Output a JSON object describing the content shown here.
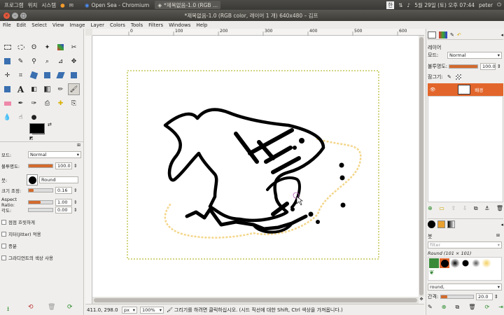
{
  "topbar": {
    "menus": [
      "프로그램",
      "위치",
      "시스템"
    ],
    "tasks": [
      "Open Sea - Chromium",
      "*제목없음-1.0 (RGB ..."
    ],
    "clock": "5월 29일 (토) 오후 07:44",
    "user": "peter",
    "ime": "한"
  },
  "window": {
    "title": "*제목없음-1.0 (RGB color, 레이어 1 개) 640x480 – 김프"
  },
  "menubar": [
    "File",
    "Edit",
    "Select",
    "View",
    "Image",
    "Layer",
    "Colors",
    "Tools",
    "Filters",
    "Windows",
    "Help"
  ],
  "tool_options": {
    "mode_label": "모드:",
    "mode_value": "Normal",
    "opacity_label": "불투명도:",
    "opacity_value": "100.0",
    "brush_label": "붓:",
    "brush_value": "Round",
    "scale_label": "크기 조정:",
    "scale_value": "0.16",
    "aspect_label": "Aspect Ratio:",
    "aspect_value": "1.00",
    "angle_label": "각도:",
    "angle_value": "0.00",
    "checkbox_fade": "점점 흐릿하게",
    "checkbox_jitter": "지터(Jitter) 적용",
    "checkbox_incremental": "증분",
    "checkbox_gradient": "그라디언트의 색상 사용"
  },
  "statusbar": {
    "coords": "411.0, 298.0",
    "unit": "px",
    "zoom": "100%",
    "message": "그리기를 하려면 클릭하십시오. (시드 직선에 대한 Shift, Ctrl 색상을 가져옵니다.)"
  },
  "layers": {
    "title": "레이어",
    "mode_label": "모드:",
    "mode_value": "Normal",
    "opacity_label": "불투명도:",
    "opacity_value": "100.0",
    "lock_label": "잠그기:",
    "layer_name": "배경"
  },
  "brushes": {
    "title": "붓",
    "filter_placeholder": "filter",
    "brush_name": "Round (101 × 101)",
    "tag_value": "round,",
    "spacing_label": "간격:",
    "spacing_value": "20.0"
  },
  "colors": {
    "accent": "#e2662b",
    "foreground": "#000000",
    "background": "#ffffff"
  },
  "ruler_ticks": [
    "0",
    "100",
    "200",
    "300",
    "400",
    "500",
    "600"
  ]
}
